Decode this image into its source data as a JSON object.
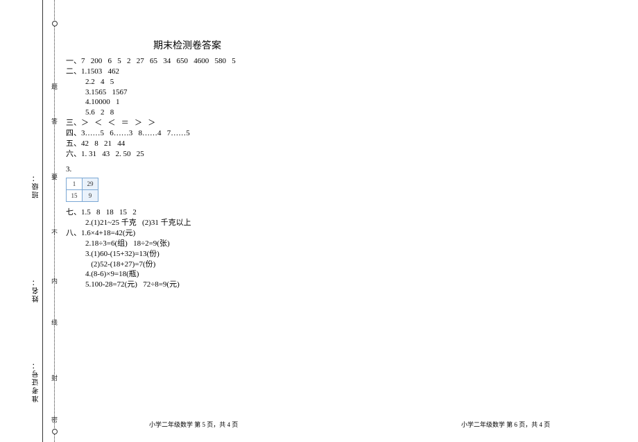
{
  "margin": {
    "class_label": "班级：",
    "name_label": "姓名：",
    "exam_label": "准考证号：",
    "hint_top": "题",
    "hint_ans": "答",
    "hint_need": "要",
    "hint_not": "不",
    "hint_in": "内",
    "hint_line": "线",
    "hint_seal": "封",
    "hint_secret": "密"
  },
  "title": "期末检测卷答案",
  "lines": {
    "l1": "一、7   200   6   5   2   27   65   34   650   4600   580   5",
    "l2": "二、1.1503   462",
    "l3": "2.2   4   5",
    "l4": "3.1565   1567",
    "l5": "4.10000   1",
    "l6": "5.6   2   8",
    "l7": "三、＞   ＜   ＜   ＝   ＞   ＞",
    "l8": "四、3……5   6……3   8……4   7……5",
    "l9": "五、42   8   21   44",
    "l10": "六、1. 31   43   2. 50   25",
    "l11": "3.",
    "l12": "七、1.5   8   18   15   2",
    "l13": "2.(1)21~25 千克   (2)31 千克以上",
    "l14": "八、1.6×4+18=42(元)",
    "l15": "2.18÷3=6(组)   18÷2=9(张)",
    "l16": "3.(1)60-(15+32)=13(份)",
    "l17": "   (2)52-(18+27)=7(份)",
    "l18": "4.(8-6)×9=18(瓶)",
    "l19": "5.100-28=72(元)   72÷8=9(元)"
  },
  "table": {
    "r1c1": "1",
    "r1c2": "29",
    "r2c1": "15",
    "r2c2": "9"
  },
  "footer": {
    "left": "小学二年级数学   第 5 页，共 4 页",
    "right": "小学二年级数学  第 6 页，共 4 页"
  }
}
